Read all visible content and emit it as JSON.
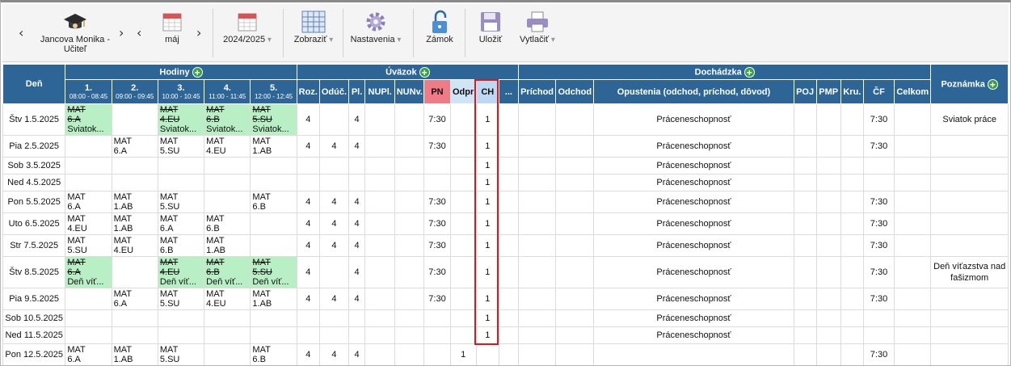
{
  "toolbar": {
    "user_line1": "Jancova Monika -",
    "user_line2": "Učiteľ",
    "month": "máj",
    "year": "2024/2025",
    "show": "Zobraziť",
    "settings": "Nastavenia",
    "lock": "Zámok",
    "save": "Uložiť",
    "print": "Vytlačiť"
  },
  "header": {
    "day": "Deň",
    "hours": "Hodiny",
    "workload": "Úväzok",
    "attendance": "Dochádzka",
    "note": "Poznámka",
    "periods": [
      {
        "num": "1.",
        "time": "08:00 - 08:45"
      },
      {
        "num": "2.",
        "time": "09:00 - 09:45"
      },
      {
        "num": "3.",
        "time": "10:00 - 10:45"
      },
      {
        "num": "4.",
        "time": "11:00 - 11:45"
      },
      {
        "num": "5.",
        "time": "12:00 - 12:45"
      }
    ],
    "workload_cols": [
      "Roz.",
      "Odúč.",
      "Pl.",
      "NUPl.",
      "NUNv.",
      "PN",
      "Odpr",
      "CH",
      "..."
    ],
    "attendance_cols": [
      "Príchod",
      "Odchod",
      "Opustenia (odchod, príchod, dôvod)",
      "POJ",
      "PMP",
      "Kru.",
      "ČF",
      "Celkom"
    ]
  },
  "rows": [
    {
      "day": "Štv 1.5.2025",
      "green": true,
      "p": [
        [
          "MAT",
          "6.A",
          "Sviatok..."
        ],
        [],
        [
          "MAT",
          "4.EU",
          "Sviatok..."
        ],
        [
          "MAT",
          "6.B",
          "Sviatok..."
        ],
        [
          "MAT",
          "5.SU",
          "Sviatok..."
        ]
      ],
      "roz": "4",
      "oduc": "",
      "pl": "4",
      "pn": "7:30",
      "odpr": "",
      "ch": "1",
      "opust": "Práceneschopnosť",
      "cf": "7:30",
      "note": "Sviatok práce"
    },
    {
      "day": "Pia 2.5.2025",
      "green": false,
      "p": [
        [],
        [
          "MAT",
          "6.A"
        ],
        [
          "MAT",
          "5.SU"
        ],
        [
          "MAT",
          "4.EU"
        ],
        [
          "MAT",
          "1.AB"
        ]
      ],
      "roz": "4",
      "oduc": "4",
      "pl": "4",
      "pn": "7:30",
      "odpr": "",
      "ch": "1",
      "opust": "Práceneschopnosť",
      "cf": "7:30",
      "note": ""
    },
    {
      "day": "Sob 3.5.2025",
      "green": false,
      "p": [
        [],
        [],
        [],
        [],
        []
      ],
      "roz": "",
      "oduc": "",
      "pl": "",
      "pn": "",
      "odpr": "",
      "ch": "1",
      "opust": "Práceneschopnosť",
      "cf": "",
      "note": ""
    },
    {
      "day": "Ned 4.5.2025",
      "green": false,
      "p": [
        [],
        [],
        [],
        [],
        []
      ],
      "roz": "",
      "oduc": "",
      "pl": "",
      "pn": "",
      "odpr": "",
      "ch": "1",
      "opust": "Práceneschopnosť",
      "cf": "",
      "note": ""
    },
    {
      "day": "Pon 5.5.2025",
      "green": false,
      "p": [
        [
          "MAT",
          "6.A"
        ],
        [
          "MAT",
          "1.AB"
        ],
        [
          "MAT",
          "5.SU"
        ],
        [],
        [
          "MAT",
          "6.B"
        ]
      ],
      "roz": "4",
      "oduc": "4",
      "pl": "4",
      "pn": "7:30",
      "odpr": "",
      "ch": "1",
      "opust": "Práceneschopnosť",
      "cf": "7:30",
      "note": ""
    },
    {
      "day": "Uto 6.5.2025",
      "green": false,
      "p": [
        [
          "MAT",
          "4.EU"
        ],
        [
          "MAT",
          "1.AB"
        ],
        [
          "MAT",
          "6.A"
        ],
        [
          "MAT",
          "6.B"
        ],
        []
      ],
      "roz": "4",
      "oduc": "4",
      "pl": "4",
      "pn": "7:30",
      "odpr": "",
      "ch": "1",
      "opust": "Práceneschopnosť",
      "cf": "7:30",
      "note": ""
    },
    {
      "day": "Str 7.5.2025",
      "green": false,
      "p": [
        [
          "MAT",
          "5.SU"
        ],
        [
          "MAT",
          "4.EU"
        ],
        [
          "MAT",
          "6.B"
        ],
        [
          "MAT",
          "1.AB"
        ],
        []
      ],
      "roz": "4",
      "oduc": "4",
      "pl": "4",
      "pn": "7:30",
      "odpr": "",
      "ch": "1",
      "opust": "Práceneschopnosť",
      "cf": "7:30",
      "note": ""
    },
    {
      "day": "Štv 8.5.2025",
      "green": true,
      "p": [
        [
          "MAT",
          "6.A",
          "Deň víť..."
        ],
        [],
        [
          "MAT",
          "4.EU",
          "Deň víť..."
        ],
        [
          "MAT",
          "6.B",
          "Deň víť..."
        ],
        [
          "MAT",
          "5.SU",
          "Deň víť..."
        ]
      ],
      "roz": "4",
      "oduc": "",
      "pl": "4",
      "pn": "7:30",
      "odpr": "",
      "ch": "1",
      "opust": "Práceneschopnosť",
      "cf": "7:30",
      "note": "Deň víťazstva nad fašizmom"
    },
    {
      "day": "Pia 9.5.2025",
      "green": false,
      "p": [
        [],
        [
          "MAT",
          "6.A"
        ],
        [
          "MAT",
          "5.SU"
        ],
        [
          "MAT",
          "4.EU"
        ],
        [
          "MAT",
          "1.AB"
        ]
      ],
      "roz": "4",
      "oduc": "4",
      "pl": "4",
      "pn": "7:30",
      "odpr": "",
      "ch": "1",
      "opust": "Práceneschopnosť",
      "cf": "7:30",
      "note": ""
    },
    {
      "day": "Sob 10.5.2025",
      "green": false,
      "p": [
        [],
        [],
        [],
        [],
        []
      ],
      "roz": "",
      "oduc": "",
      "pl": "",
      "pn": "",
      "odpr": "",
      "ch": "1",
      "opust": "Práceneschopnosť",
      "cf": "",
      "note": ""
    },
    {
      "day": "Ned 11.5.2025",
      "green": false,
      "p": [
        [],
        [],
        [],
        [],
        []
      ],
      "roz": "",
      "oduc": "",
      "pl": "",
      "pn": "",
      "odpr": "",
      "ch": "1",
      "opust": "Práceneschopnosť",
      "cf": "",
      "note": ""
    },
    {
      "day": "Pon 12.5.2025",
      "green": false,
      "p": [
        [
          "MAT",
          "6.A"
        ],
        [
          "MAT",
          "1.AB"
        ],
        [
          "MAT",
          "5.SU"
        ],
        [],
        [
          "MAT",
          "6.B"
        ]
      ],
      "roz": "4",
      "oduc": "4",
      "pl": "4",
      "pn": "",
      "odpr": "1",
      "ch": "",
      "opust": "",
      "cf": "7:30",
      "note": ""
    }
  ],
  "colors": {
    "header": "#2e6597",
    "pn": "#ee7b86",
    "ch": "#bcd8f3",
    "holiday": "#b9efc4",
    "highlight": "#e0161a"
  }
}
